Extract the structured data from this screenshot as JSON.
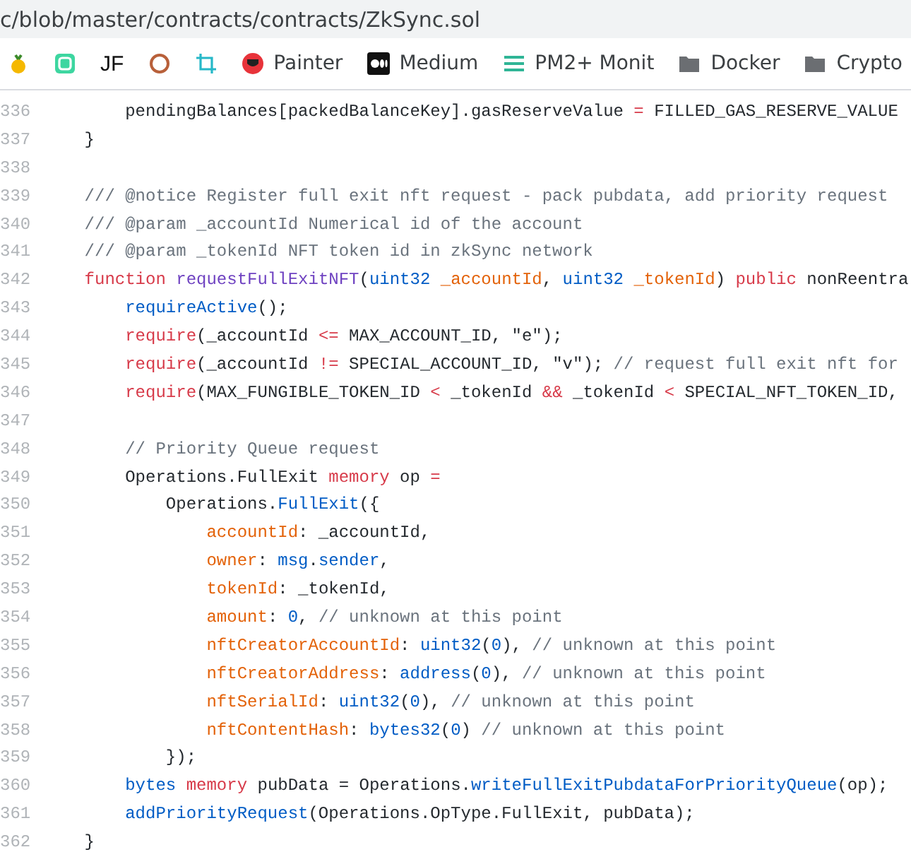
{
  "address_bar": {
    "url": "c/blob/master/contracts/contracts/ZkSync.sol"
  },
  "bookmarks": [
    {
      "kind": "fruit"
    },
    {
      "kind": "app"
    },
    {
      "kind": "text",
      "label": "JF"
    },
    {
      "kind": "ring"
    },
    {
      "kind": "crop"
    },
    {
      "kind": "painter",
      "label": "Painter"
    },
    {
      "kind": "medium",
      "label": "Medium"
    },
    {
      "kind": "lines",
      "label": "PM2+ Monit"
    },
    {
      "kind": "folder",
      "label": "Docker"
    },
    {
      "kind": "folder",
      "label": "Crypto"
    }
  ],
  "code_lines": [
    {
      "number": "336",
      "tokens": [
        {
          "kind": "plain",
          "text": "        pendingBalances[packedBalanceKey].gasReserveValue "
        },
        {
          "kind": "keyword",
          "text": "="
        },
        {
          "kind": "plain",
          "text": " FILLED_GAS_RESERVE_VALUE"
        }
      ]
    },
    {
      "number": "337",
      "tokens": [
        {
          "kind": "plain",
          "text": "    }"
        }
      ]
    },
    {
      "number": "338"
    },
    {
      "number": "339",
      "tokens": [
        {
          "kind": "comment",
          "text": "    /// @notice Register full exit nft request - pack pubdata, add priority request"
        }
      ]
    },
    {
      "number": "340",
      "tokens": [
        {
          "kind": "comment",
          "text": "    /// @param _accountId Numerical id of the account"
        }
      ]
    },
    {
      "number": "341",
      "tokens": [
        {
          "kind": "comment",
          "text": "    /// @param _tokenId NFT token id in zkSync network"
        }
      ]
    },
    {
      "number": "342",
      "tokens": [
        {
          "kind": "keyword",
          "text": "    function"
        },
        {
          "kind": "function",
          "text": " requestFullExitNFT"
        },
        {
          "kind": "plain",
          "text": "("
        },
        {
          "kind": "type",
          "text": "uint32"
        },
        {
          "kind": "param",
          "text": " _accountId"
        },
        {
          "kind": "plain",
          "text": ","
        },
        {
          "kind": "type",
          "text": " uint32"
        },
        {
          "kind": "param",
          "text": " _tokenId"
        },
        {
          "kind": "plain",
          "text": ")"
        },
        {
          "kind": "keyword",
          "text": " public"
        },
        {
          "kind": "plain",
          "text": " nonReentra"
        }
      ]
    },
    {
      "number": "343",
      "tokens": [
        {
          "kind": "call",
          "text": "        requireActive"
        },
        {
          "kind": "plain",
          "text": "();"
        }
      ]
    },
    {
      "number": "344",
      "tokens": [
        {
          "kind": "keyword",
          "text": "        require"
        },
        {
          "kind": "plain",
          "text": "(_accountId "
        },
        {
          "kind": "keyword",
          "text": "<="
        },
        {
          "kind": "plain",
          "text": " MAX_ACCOUNT_ID, \"e\");"
        }
      ]
    },
    {
      "number": "345",
      "tokens": [
        {
          "kind": "keyword",
          "text": "        require"
        },
        {
          "kind": "plain",
          "text": "(_accountId "
        },
        {
          "kind": "keyword",
          "text": "!="
        },
        {
          "kind": "plain",
          "text": " SPECIAL_ACCOUNT_ID, \"v\"); "
        },
        {
          "kind": "comment",
          "text": "// request full exit nft for"
        }
      ]
    },
    {
      "number": "346",
      "tokens": [
        {
          "kind": "keyword",
          "text": "        require"
        },
        {
          "kind": "plain",
          "text": "(MAX_FUNGIBLE_TOKEN_ID "
        },
        {
          "kind": "keyword",
          "text": "<"
        },
        {
          "kind": "plain",
          "text": " _tokenId "
        },
        {
          "kind": "keyword",
          "text": "&&"
        },
        {
          "kind": "plain",
          "text": " _tokenId "
        },
        {
          "kind": "keyword",
          "text": "<"
        },
        {
          "kind": "plain",
          "text": " SPECIAL_NFT_TOKEN_ID,"
        }
      ]
    },
    {
      "number": "347"
    },
    {
      "number": "348",
      "tokens": [
        {
          "kind": "comment",
          "text": "        // Priority Queue request"
        }
      ]
    },
    {
      "number": "349",
      "tokens": [
        {
          "kind": "plain",
          "text": "        Operations.FullExit "
        },
        {
          "kind": "keyword",
          "text": "memory"
        },
        {
          "kind": "plain",
          "text": " op "
        },
        {
          "kind": "keyword",
          "text": "="
        }
      ]
    },
    {
      "number": "350",
      "tokens": [
        {
          "kind": "plain",
          "text": "            Operations."
        },
        {
          "kind": "call",
          "text": "FullExit"
        },
        {
          "kind": "plain",
          "text": "({"
        }
      ]
    },
    {
      "number": "351",
      "tokens": [
        {
          "kind": "param",
          "text": "                accountId"
        },
        {
          "kind": "plain",
          "text": ": _accountId,"
        }
      ]
    },
    {
      "number": "352",
      "tokens": [
        {
          "kind": "param",
          "text": "                owner"
        },
        {
          "kind": "plain",
          "text": ":"
        },
        {
          "kind": "call",
          "text": " msg"
        },
        {
          "kind": "plain",
          "text": "."
        },
        {
          "kind": "call",
          "text": "sender"
        },
        {
          "kind": "plain",
          "text": ","
        }
      ]
    },
    {
      "number": "353",
      "tokens": [
        {
          "kind": "param",
          "text": "                tokenId"
        },
        {
          "kind": "plain",
          "text": ": _tokenId,"
        }
      ]
    },
    {
      "number": "354",
      "tokens": [
        {
          "kind": "param",
          "text": "                amount"
        },
        {
          "kind": "plain",
          "text": ":"
        },
        {
          "kind": "call",
          "text": " 0"
        },
        {
          "kind": "plain",
          "text": ","
        },
        {
          "kind": "comment",
          "text": " // unknown at this point"
        }
      ]
    },
    {
      "number": "355",
      "tokens": [
        {
          "kind": "param",
          "text": "                nftCreatorAccountId"
        },
        {
          "kind": "plain",
          "text": ":"
        },
        {
          "kind": "call",
          "text": " uint32"
        },
        {
          "kind": "plain",
          "text": "("
        },
        {
          "kind": "call",
          "text": "0"
        },
        {
          "kind": "plain",
          "text": "),"
        },
        {
          "kind": "comment",
          "text": " // unknown at this point"
        }
      ]
    },
    {
      "number": "356",
      "tokens": [
        {
          "kind": "param",
          "text": "                nftCreatorAddress"
        },
        {
          "kind": "plain",
          "text": ":"
        },
        {
          "kind": "call",
          "text": " address"
        },
        {
          "kind": "plain",
          "text": "("
        },
        {
          "kind": "call",
          "text": "0"
        },
        {
          "kind": "plain",
          "text": "),"
        },
        {
          "kind": "comment",
          "text": " // unknown at this point"
        }
      ]
    },
    {
      "number": "357",
      "tokens": [
        {
          "kind": "param",
          "text": "                nftSerialId"
        },
        {
          "kind": "plain",
          "text": ":"
        },
        {
          "kind": "call",
          "text": " uint32"
        },
        {
          "kind": "plain",
          "text": "("
        },
        {
          "kind": "call",
          "text": "0"
        },
        {
          "kind": "plain",
          "text": "),"
        },
        {
          "kind": "comment",
          "text": " // unknown at this point"
        }
      ]
    },
    {
      "number": "358",
      "tokens": [
        {
          "kind": "param",
          "text": "                nftContentHash"
        },
        {
          "kind": "plain",
          "text": ":"
        },
        {
          "kind": "call",
          "text": " bytes32"
        },
        {
          "kind": "plain",
          "text": "("
        },
        {
          "kind": "call",
          "text": "0"
        },
        {
          "kind": "plain",
          "text": ")"
        },
        {
          "kind": "comment",
          "text": " // unknown at this point"
        }
      ]
    },
    {
      "number": "359",
      "tokens": [
        {
          "kind": "plain",
          "text": "            });"
        }
      ]
    },
    {
      "number": "360",
      "tokens": [
        {
          "kind": "call",
          "text": "        bytes"
        },
        {
          "kind": "keyword",
          "text": " memory"
        },
        {
          "kind": "plain",
          "text": " pubData = Operations."
        },
        {
          "kind": "call",
          "text": "writeFullExitPubdataForPriorityQueue"
        },
        {
          "kind": "plain",
          "text": "(op);"
        }
      ]
    },
    {
      "number": "361",
      "tokens": [
        {
          "kind": "call",
          "text": "        addPriorityRequest"
        },
        {
          "kind": "plain",
          "text": "(Operations.OpType.FullExit, pubData);"
        }
      ]
    },
    {
      "number": "362",
      "tokens": [
        {
          "kind": "plain",
          "text": "    }"
        }
      ]
    }
  ]
}
